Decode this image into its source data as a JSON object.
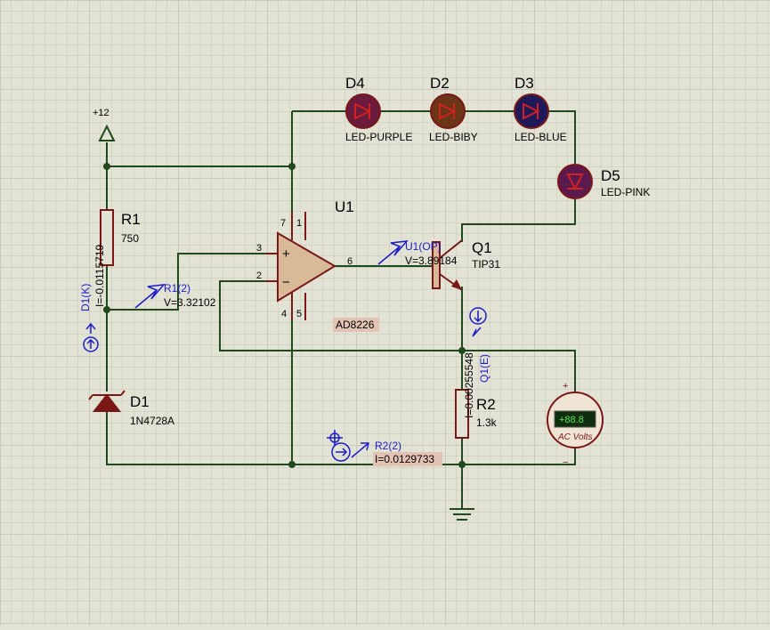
{
  "diagram": {
    "power": {
      "label": "+12"
    },
    "r1": {
      "ref": "R1",
      "value": "750"
    },
    "d1": {
      "ref": "D1",
      "value": "1N4728A"
    },
    "u1": {
      "ref": "U1",
      "value": "AD8226",
      "pin7": "7",
      "pin1": "1",
      "pin3": "3",
      "pin2": "2",
      "pin6": "6",
      "pin4": "4",
      "pin5": "5",
      "plus": "+",
      "minus": "−"
    },
    "q1": {
      "ref": "Q1",
      "value": "TIP31"
    },
    "r2": {
      "ref": "R2",
      "value": "1.3k"
    },
    "leds": [
      {
        "ref": "D4",
        "value": "LED-PURPLE",
        "color": "#6a1a3c"
      },
      {
        "ref": "D2",
        "value": "LED-BIBY",
        "color": "#6b3518"
      },
      {
        "ref": "D3",
        "value": "LED-BLUE",
        "color": "#1e1a5a"
      },
      {
        "ref": "D5",
        "value": "LED-PINK",
        "color": "#5a1a4e"
      }
    ],
    "probes": {
      "r1_2": {
        "name": "R1(2)",
        "reading": "V=3.32102"
      },
      "u1_op": {
        "name": "U1(OP)",
        "reading": "V=3.89184"
      },
      "d1_k": {
        "name": "D1(K)",
        "reading": "I=-0.0115719"
      },
      "q1_e": {
        "name": "Q1(E)",
        "reading": "I=0.00255548"
      },
      "r2_2": {
        "name": "R2(2)",
        "reading": "I=0.0129733"
      }
    },
    "voltmeter": {
      "display": "+88.8",
      "label": "AC Volts",
      "plus": "+",
      "minus": "−"
    }
  },
  "colors": {
    "background": "#e3e3d5",
    "wire": "#1e4a1e",
    "component": "#7a1818",
    "probe": "#1c1cc8"
  }
}
